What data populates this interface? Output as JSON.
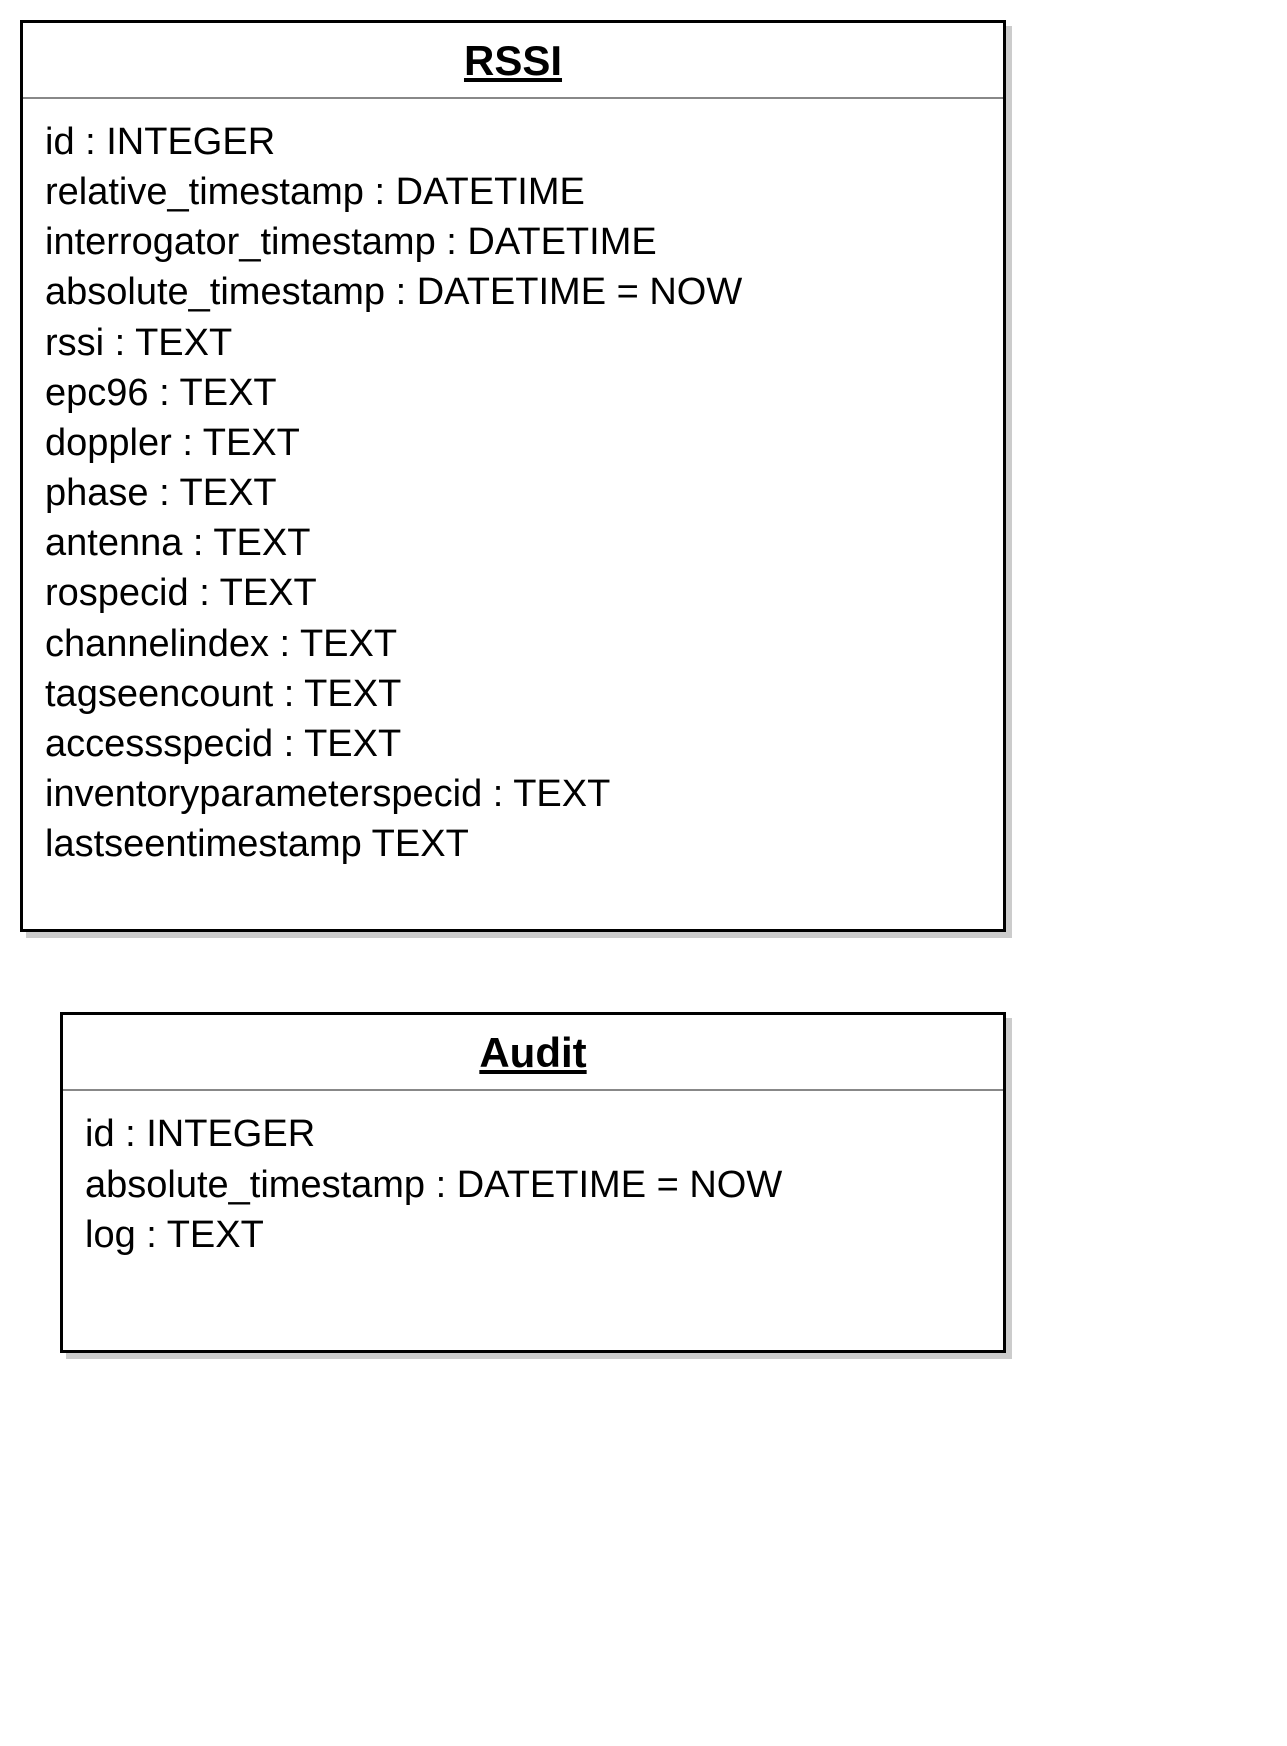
{
  "classes": [
    {
      "id": "rssi",
      "name": "RSSI",
      "attributes": [
        "id : INTEGER",
        "relative_timestamp : DATETIME",
        "interrogator_timestamp : DATETIME",
        "absolute_timestamp : DATETIME = NOW",
        "rssi : TEXT",
        "epc96 : TEXT",
        "doppler : TEXT",
        "phase : TEXT",
        "antenna : TEXT",
        "rospecid : TEXT",
        "channelindex : TEXT",
        "tagseencount : TEXT",
        "accessspecid : TEXT",
        "inventoryparameterspecid : TEXT",
        "lastseentimestamp TEXT"
      ]
    },
    {
      "id": "audit",
      "name": "Audit",
      "attributes": [
        "id : INTEGER",
        "absolute_timestamp : DATETIME = NOW",
        "log : TEXT"
      ]
    }
  ]
}
